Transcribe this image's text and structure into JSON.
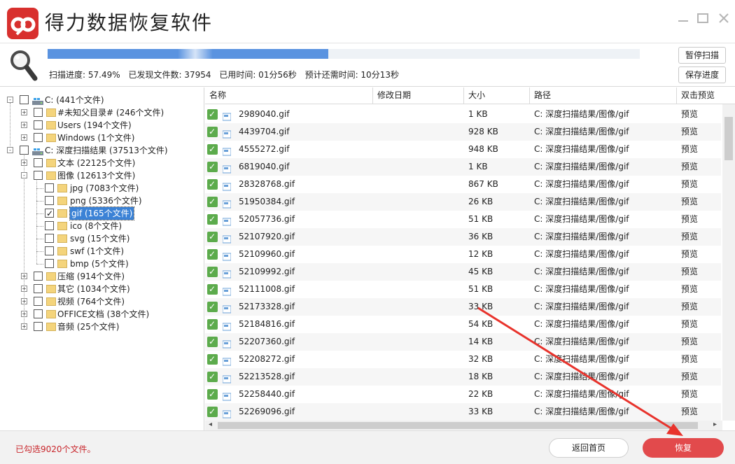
{
  "app": {
    "title": "得力数据恢复软件",
    "brand_color": "#d8302e"
  },
  "scan": {
    "progress_percent": 57.49,
    "progress_label": "扫描进度: 57.49%",
    "found_label": "已发现文件数: 37954",
    "elapsed_label": "已用时间: 01分56秒",
    "remaining_label": "预计还需时间: 10分13秒",
    "pause_label": "暂停扫描",
    "save_label": "保存进度",
    "bar_color": "#5a93e0"
  },
  "tree": {
    "nodes": [
      {
        "label": "C:  (441个文件)",
        "icon": "drive-icon"
      },
      {
        "label": "#未知父目录#  (246个文件)",
        "icon": "folder-icon"
      },
      {
        "label": "Users  (194个文件)",
        "icon": "folder-icon"
      },
      {
        "label": "Windows  (1个文件)",
        "icon": "folder-icon"
      },
      {
        "label": "C: 深度扫描结果  (37513个文件)",
        "icon": "drive-icon"
      },
      {
        "label": "文本  (22125个文件)",
        "icon": "folder-icon"
      },
      {
        "label": "图像  (12613个文件)",
        "icon": "folder-icon"
      },
      {
        "label": "jpg  (7083个文件)",
        "icon": "folder-icon"
      },
      {
        "label": "png  (5336个文件)",
        "icon": "folder-icon"
      },
      {
        "label": "gif  (165个文件)",
        "icon": "folder-icon",
        "selected": true,
        "checked": true
      },
      {
        "label": "ico  (8个文件)",
        "icon": "folder-icon"
      },
      {
        "label": "svg  (15个文件)",
        "icon": "folder-icon"
      },
      {
        "label": "swf  (1个文件)",
        "icon": "folder-icon"
      },
      {
        "label": "bmp  (5个文件)",
        "icon": "folder-icon"
      },
      {
        "label": "压缩  (914个文件)",
        "icon": "folder-icon"
      },
      {
        "label": "其它  (1034个文件)",
        "icon": "folder-icon"
      },
      {
        "label": "视频  (764个文件)",
        "icon": "folder-icon"
      },
      {
        "label": "OFFICE文档  (38个文件)",
        "icon": "folder-icon"
      },
      {
        "label": "音频  (25个文件)",
        "icon": "folder-icon"
      }
    ]
  },
  "list": {
    "columns": [
      "名称",
      "修改日期",
      "大小",
      "路径",
      "双击预览"
    ],
    "rows": [
      {
        "name": "2989040.gif",
        "date": "",
        "size": "1 KB",
        "path": "C: 深度扫描结果/图像/gif",
        "preview": "预览"
      },
      {
        "name": "4439704.gif",
        "date": "",
        "size": "928 KB",
        "path": "C: 深度扫描结果/图像/gif",
        "preview": "预览"
      },
      {
        "name": "4555272.gif",
        "date": "",
        "size": "948 KB",
        "path": "C: 深度扫描结果/图像/gif",
        "preview": "预览"
      },
      {
        "name": "6819040.gif",
        "date": "",
        "size": "1 KB",
        "path": "C: 深度扫描结果/图像/gif",
        "preview": "预览"
      },
      {
        "name": "28328768.gif",
        "date": "",
        "size": "867 KB",
        "path": "C: 深度扫描结果/图像/gif",
        "preview": "预览"
      },
      {
        "name": "51950384.gif",
        "date": "",
        "size": "26 KB",
        "path": "C: 深度扫描结果/图像/gif",
        "preview": "预览"
      },
      {
        "name": "52057736.gif",
        "date": "",
        "size": "51 KB",
        "path": "C: 深度扫描结果/图像/gif",
        "preview": "预览"
      },
      {
        "name": "52107920.gif",
        "date": "",
        "size": "36 KB",
        "path": "C: 深度扫描结果/图像/gif",
        "preview": "预览"
      },
      {
        "name": "52109960.gif",
        "date": "",
        "size": "12 KB",
        "path": "C: 深度扫描结果/图像/gif",
        "preview": "预览"
      },
      {
        "name": "52109992.gif",
        "date": "",
        "size": "45 KB",
        "path": "C: 深度扫描结果/图像/gif",
        "preview": "预览"
      },
      {
        "name": "52111008.gif",
        "date": "",
        "size": "51 KB",
        "path": "C: 深度扫描结果/图像/gif",
        "preview": "预览"
      },
      {
        "name": "52173328.gif",
        "date": "",
        "size": "33 KB",
        "path": "C: 深度扫描结果/图像/gif",
        "preview": "预览"
      },
      {
        "name": "52184816.gif",
        "date": "",
        "size": "54 KB",
        "path": "C: 深度扫描结果/图像/gif",
        "preview": "预览"
      },
      {
        "name": "52207360.gif",
        "date": "",
        "size": "14 KB",
        "path": "C: 深度扫描结果/图像/gif",
        "preview": "预览"
      },
      {
        "name": "52208272.gif",
        "date": "",
        "size": "32 KB",
        "path": "C: 深度扫描结果/图像/gif",
        "preview": "预览"
      },
      {
        "name": "52213528.gif",
        "date": "",
        "size": "18 KB",
        "path": "C: 深度扫描结果/图像/gif",
        "preview": "预览"
      },
      {
        "name": "52258440.gif",
        "date": "",
        "size": "22 KB",
        "path": "C: 深度扫描结果/图像/gif",
        "preview": "预览"
      },
      {
        "name": "52269096.gif",
        "date": "",
        "size": "33 KB",
        "path": "C: 深度扫描结果/图像/gif",
        "preview": "预览"
      }
    ]
  },
  "footer": {
    "selected_info": "已勾选9020个文件。",
    "back_label": "返回首页",
    "recover_label": "恢复",
    "recover_color": "#e24a4c"
  },
  "annotation": {
    "arrow_color": "#e8332c"
  }
}
